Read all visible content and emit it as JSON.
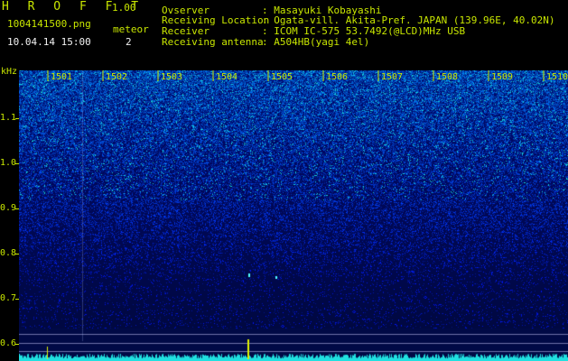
{
  "header": {
    "logo": "H R O F F T",
    "version": "1.00",
    "filename": "1004141500.png",
    "datetime": "10.04.14 15:00",
    "meteor_label": "meteor",
    "meteor_count": "2",
    "info": [
      {
        "label": "Ovserver",
        "value": ": Masayuki Kobayashi"
      },
      {
        "label": "Receiving Location",
        "value": ": Ogata-vill. Akita-Pref. JAPAN (139.96E, 40.02N)"
      },
      {
        "label": "Receiver",
        "value": ": ICOM IC-575 53.7492(@LCD)MHz USB"
      },
      {
        "label": "Receiving antenna",
        "value": ": A504HB(yagi 4el)"
      }
    ]
  },
  "colors": {
    "header_yellow": "#c8e600",
    "header_white": "#f2f2f2",
    "background": "#000000"
  },
  "chart_data": {
    "type": "heatmap",
    "ylabel": "kHz",
    "y_ticks": [
      "1.1",
      "1.0",
      "0.9",
      "0.8",
      "0.7",
      "0.6"
    ],
    "x_ticks": [
      "1501",
      "1502",
      "1503",
      "1504",
      "1505",
      "1506",
      "1507",
      "1508",
      "1509",
      "1510"
    ]
  }
}
